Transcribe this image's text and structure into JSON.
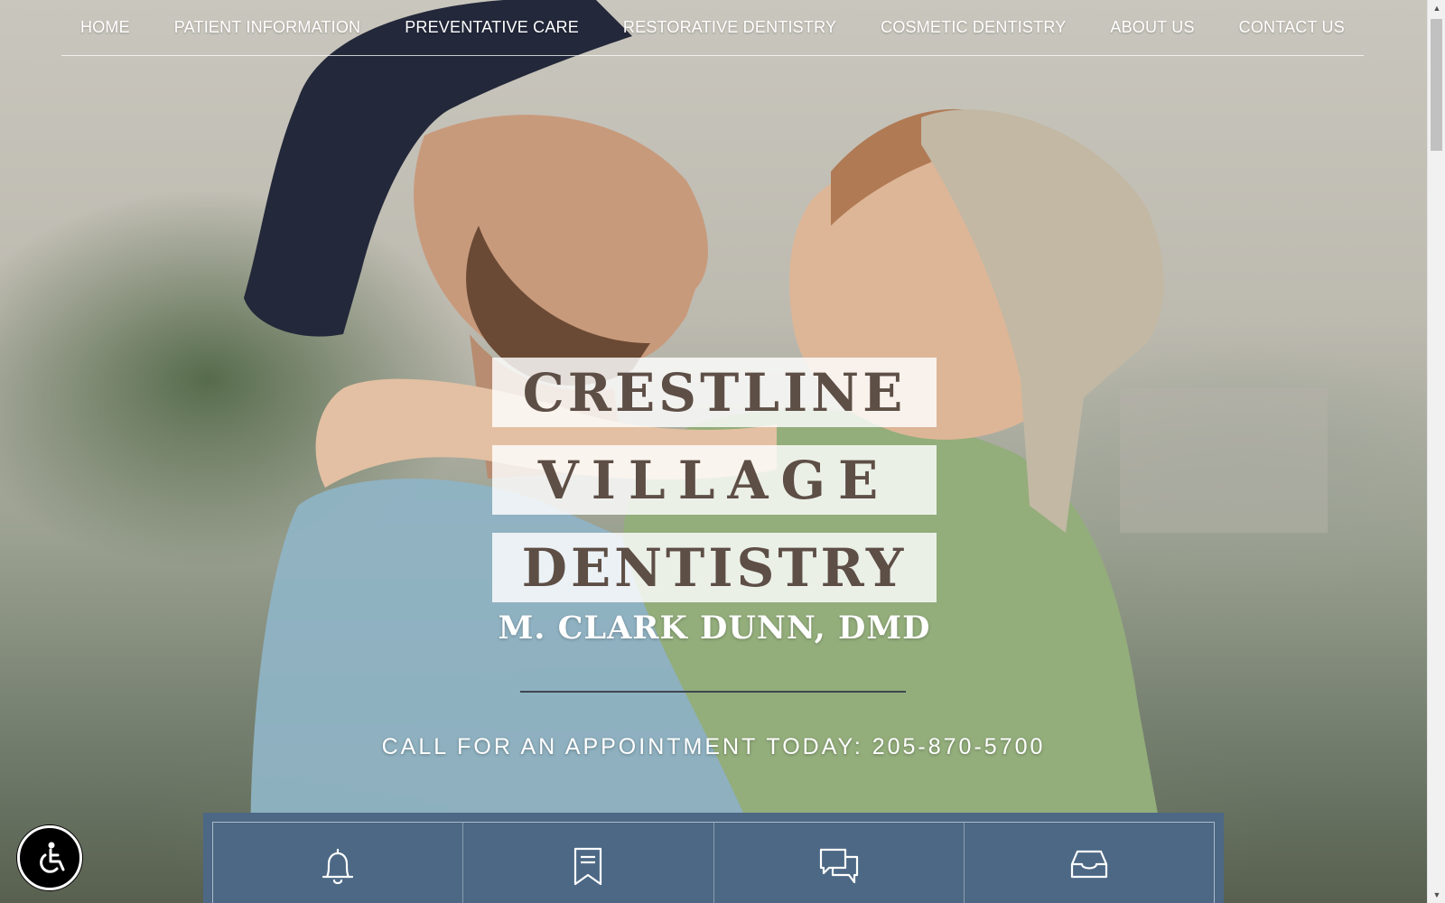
{
  "nav": {
    "items": [
      {
        "label": "HOME"
      },
      {
        "label": "PATIENT INFORMATION"
      },
      {
        "label": "PREVENTATIVE CARE"
      },
      {
        "label": "RESTORATIVE DENTISTRY"
      },
      {
        "label": "COSMETIC DENTISTRY"
      },
      {
        "label": "ABOUT US"
      },
      {
        "label": "CONTACT US"
      }
    ]
  },
  "logo": {
    "line1": "CRESTLINE",
    "line2": "VILLAGE",
    "line3": "DENTISTRY",
    "subtitle": "M. CLARK DUNN, DMD"
  },
  "cta": {
    "text": "CALL FOR AN APPOINTMENT TODAY: 205-870-5700"
  },
  "quicklinks": [
    {
      "icon": "bell-icon"
    },
    {
      "icon": "bookmark-icon"
    },
    {
      "icon": "chat-bubbles-icon"
    },
    {
      "icon": "inbox-tray-icon"
    }
  ],
  "colors": {
    "quicklinks_bg": "#4c6885",
    "logo_text": "#5d4e46"
  }
}
